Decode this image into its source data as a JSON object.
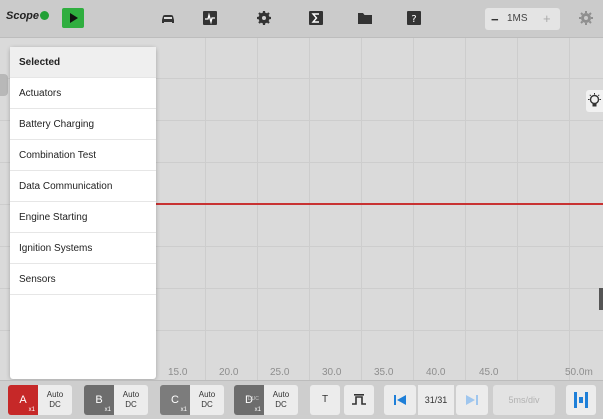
{
  "app": {
    "logo_text": "Scope",
    "zoom": {
      "minus": "−",
      "value": "1MS",
      "plus": "+"
    }
  },
  "toolbar_icons": [
    "play-icon",
    "car-icon",
    "waveform-icon",
    "settings-icon",
    "sigma-icon",
    "folder-icon",
    "help-icon",
    "gear-icon"
  ],
  "menu": {
    "items": [
      {
        "label": "Selected",
        "selected": true
      },
      {
        "label": "Actuators",
        "selected": false
      },
      {
        "label": "Battery Charging",
        "selected": false
      },
      {
        "label": "Combination Test",
        "selected": false
      },
      {
        "label": "Data Communication",
        "selected": false
      },
      {
        "label": "Engine Starting",
        "selected": false
      },
      {
        "label": "Ignition Systems",
        "selected": false
      },
      {
        "label": "Sensors",
        "selected": false
      }
    ]
  },
  "scope": {
    "x_labels": [
      "15.0",
      "20.0",
      "25.0",
      "30.0",
      "35.0",
      "40.0",
      "45.0",
      "50.0m"
    ],
    "trace_color": "#c83232"
  },
  "channels": [
    {
      "id": "A",
      "scale": "x1",
      "mode": "Auto",
      "coupling": "DC",
      "color": "#c62828"
    },
    {
      "id": "B",
      "scale": "x1",
      "mode": "Auto",
      "coupling": "DC",
      "color": "#6d6d6d"
    },
    {
      "id": "C",
      "scale": "x1",
      "mode": "Auto",
      "coupling": "DC",
      "color": "#7c7c7c"
    },
    {
      "id": "D",
      "scale": "x1",
      "mode": "Auto",
      "coupling": "DC",
      "color": "#6d6d6d",
      "extra": "DUC"
    }
  ],
  "controls": {
    "trigger": "T",
    "page": "31/31",
    "timebase": "5ms/div"
  }
}
